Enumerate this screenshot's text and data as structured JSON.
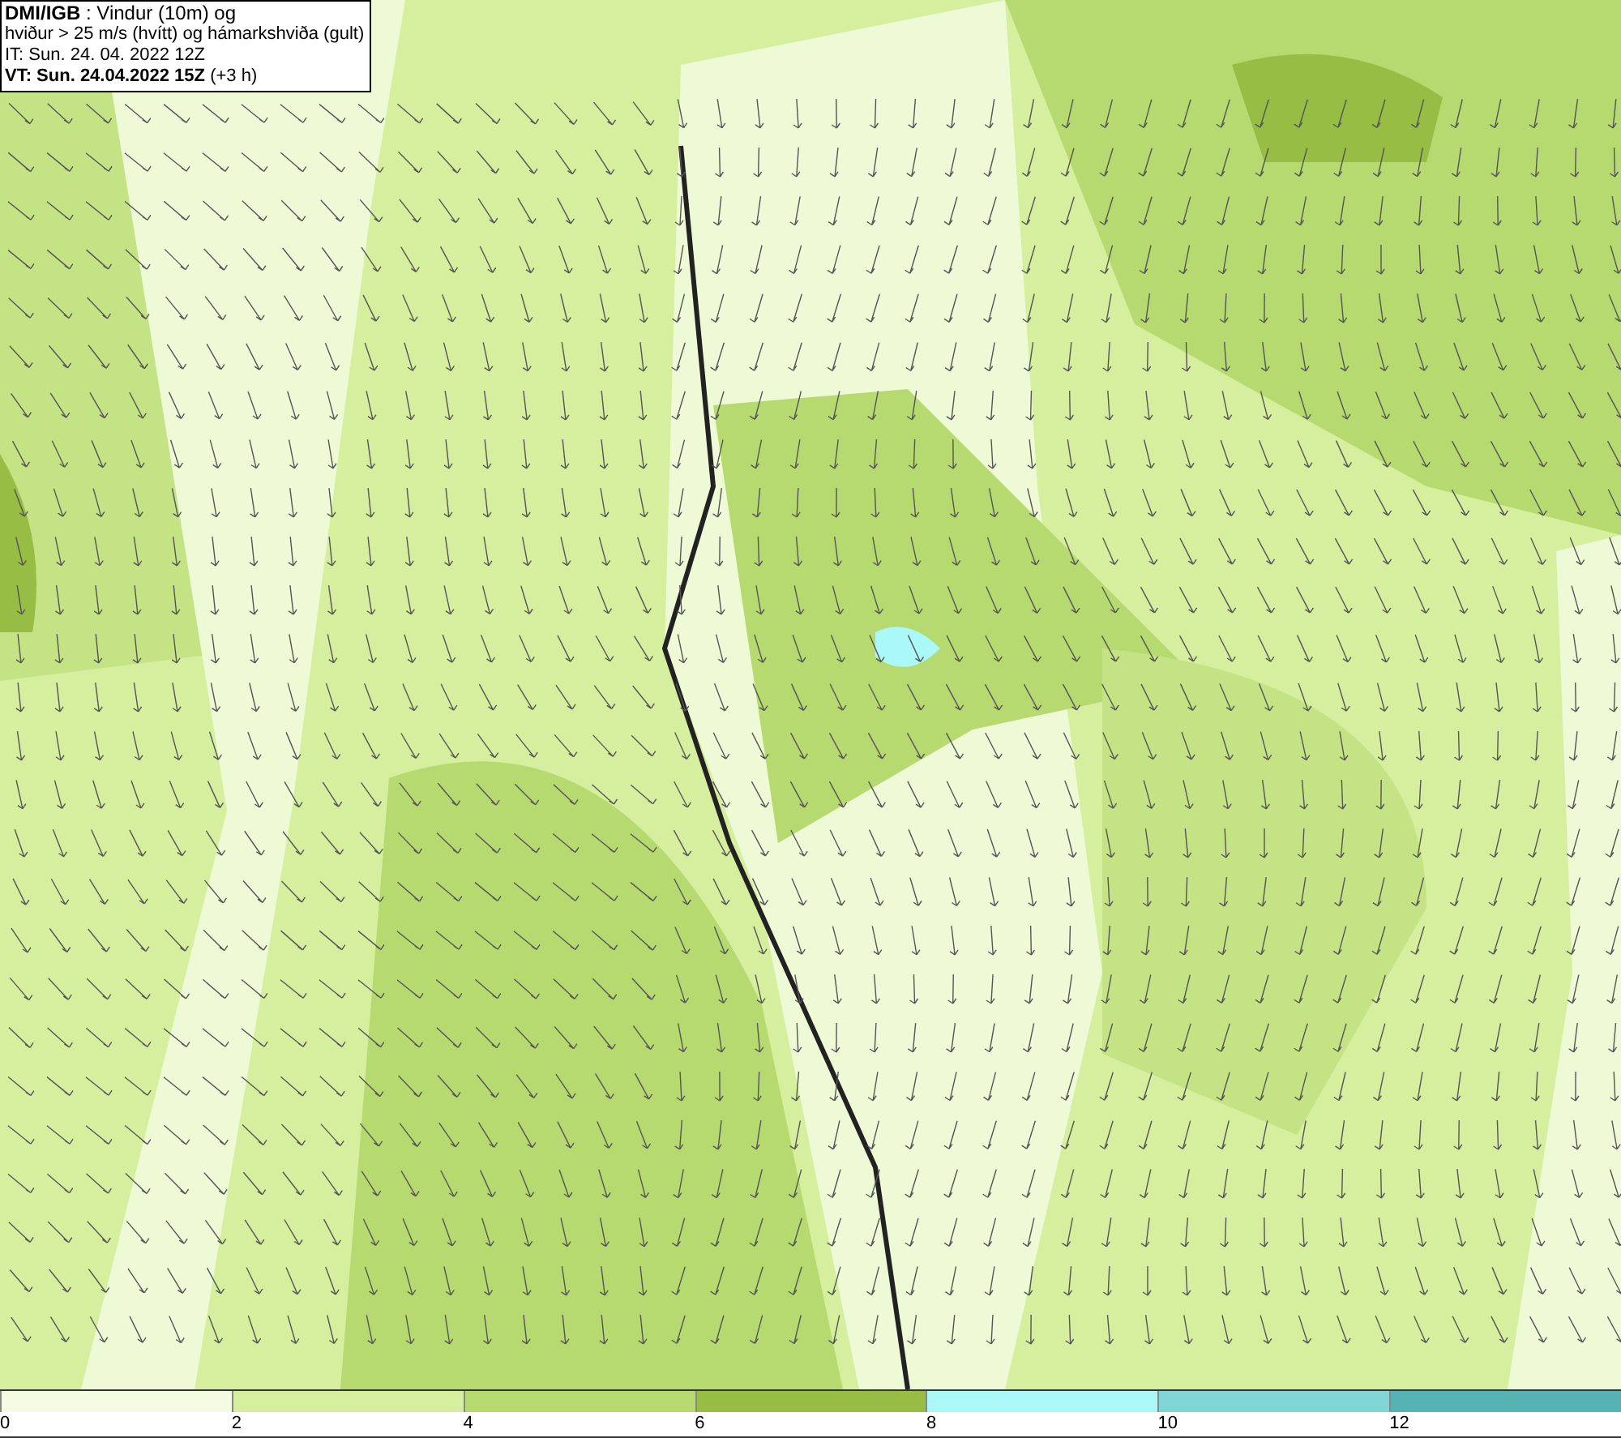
{
  "header": {
    "lines": [
      "**DMI/IGB** : Vindur (10m) og",
      "hviður > 25 m/s (hvítt) og hámarkshviða (gult)",
      "IT: Sun. 24. 04. 2022 12Z",
      "**VT: Sun. 24.04.2022 15Z** (+3 h)"
    ]
  },
  "legend": {
    "bins": [
      {
        "color": "#f3fbe0",
        "label": "0"
      },
      {
        "color": "#d5ef9e",
        "label": "2"
      },
      {
        "color": "#b6da70",
        "label": "4"
      },
      {
        "color": "#97bd45",
        "label": "6"
      },
      {
        "color": "#aaf8f8",
        "label": "8"
      },
      {
        "color": "#7fd6d4",
        "label": "10"
      },
      {
        "color": "#55b3b3",
        "label": "12"
      }
    ]
  }
}
